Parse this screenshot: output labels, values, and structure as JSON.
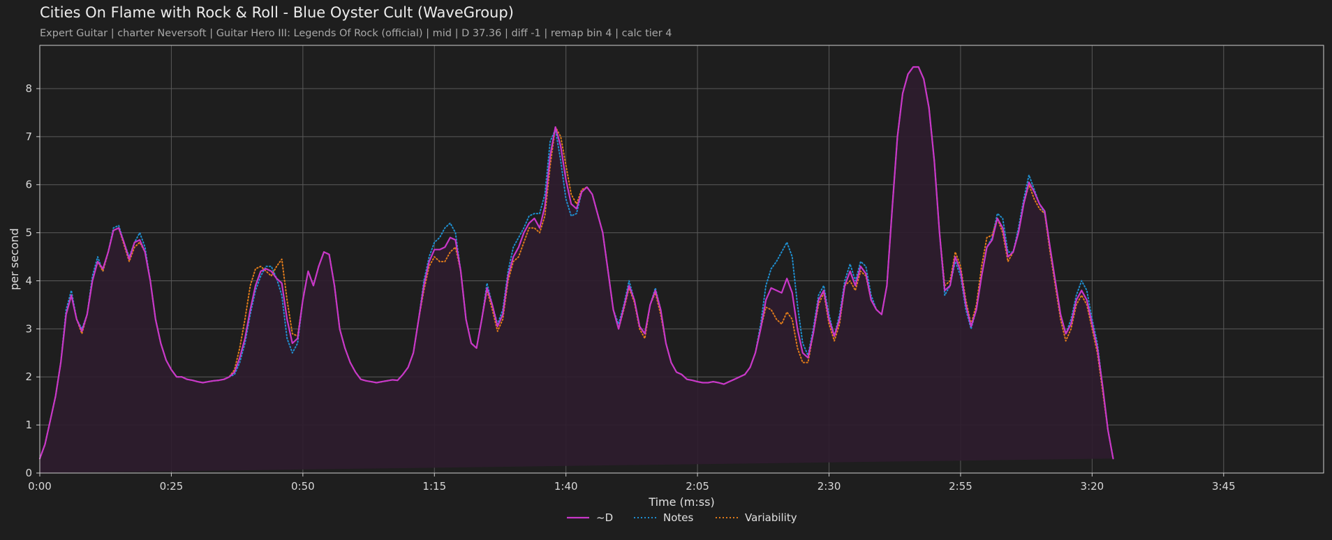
{
  "header": {
    "title": "Cities On Flame with Rock & Roll - Blue Oyster Cult (WaveGroup)",
    "subtitle": "Expert Guitar  |  charter Neversoft  |  Guitar Hero III: Legends Of Rock (official)  |  mid  |  D 37.36  |  diff -1  |  remap bin 4  |  calc tier 4"
  },
  "colors": {
    "background": "#1e1e1e",
    "d_line": "#c837c8",
    "d_fill": "#2e1c2e",
    "notes_line": "#1f8fd0",
    "variability_line": "#e07b1a",
    "grid": "#5a5a5a"
  },
  "chart_data": {
    "type": "line",
    "xlabel": "Time (m:ss)",
    "ylabel": "per second",
    "xlim": [
      0,
      244
    ],
    "ylim": [
      0,
      8.9
    ],
    "grid": true,
    "legend_position": "bottom-center",
    "xticks": [
      {
        "value": 0,
        "label": "0:00"
      },
      {
        "value": 25,
        "label": "0:25"
      },
      {
        "value": 50,
        "label": "0:50"
      },
      {
        "value": 75,
        "label": "1:15"
      },
      {
        "value": 100,
        "label": "1:40"
      },
      {
        "value": 125,
        "label": "2:05"
      },
      {
        "value": 150,
        "label": "2:30"
      },
      {
        "value": 175,
        "label": "2:55"
      },
      {
        "value": 200,
        "label": "3:20"
      },
      {
        "value": 225,
        "label": "3:45"
      }
    ],
    "yticks": [
      0,
      1,
      2,
      3,
      4,
      5,
      6,
      7,
      8
    ],
    "x": [
      0,
      1,
      2,
      3,
      4,
      5,
      6,
      7,
      8,
      9,
      10,
      11,
      12,
      13,
      14,
      15,
      16,
      17,
      18,
      19,
      20,
      21,
      22,
      23,
      24,
      25,
      26,
      27,
      28,
      29,
      30,
      31,
      32,
      33,
      34,
      35,
      36,
      37,
      38,
      39,
      40,
      41,
      42,
      43,
      44,
      45,
      46,
      47,
      48,
      49,
      50,
      51,
      52,
      53,
      54,
      55,
      56,
      57,
      58,
      59,
      60,
      61,
      62,
      63,
      64,
      65,
      66,
      67,
      68,
      69,
      70,
      71,
      72,
      73,
      74,
      75,
      76,
      77,
      78,
      79,
      80,
      81,
      82,
      83,
      84,
      85,
      86,
      87,
      88,
      89,
      90,
      91,
      92,
      93,
      94,
      95,
      96,
      97,
      98,
      99,
      100,
      101,
      102,
      103,
      104,
      105,
      106,
      107,
      108,
      109,
      110,
      111,
      112,
      113,
      114,
      115,
      116,
      117,
      118,
      119,
      120,
      121,
      122,
      123,
      124,
      125,
      126,
      127,
      128,
      129,
      130,
      131,
      132,
      133,
      134,
      135,
      136,
      137,
      138,
      139,
      140,
      141,
      142,
      143,
      144,
      145,
      146,
      147,
      148,
      149,
      150,
      151,
      152,
      153,
      154,
      155,
      156,
      157,
      158,
      159,
      160,
      161,
      162,
      163,
      164,
      165,
      166,
      167,
      168,
      169,
      170,
      171,
      172,
      173,
      174,
      175,
      176,
      177,
      178,
      179,
      180,
      181,
      182,
      183,
      184,
      185,
      186,
      187,
      188,
      189,
      190,
      191,
      192,
      193,
      194,
      195,
      196,
      197,
      198,
      199,
      200,
      201,
      202,
      203,
      204,
      205,
      206,
      207,
      208,
      209,
      210,
      211,
      212,
      213,
      214,
      215,
      216,
      217,
      218,
      219,
      220,
      221,
      222,
      223,
      224,
      225,
      226,
      227,
      228,
      229,
      230,
      231,
      232,
      233,
      234,
      235,
      236,
      237,
      238,
      239,
      240,
      241,
      242,
      243,
      244
    ],
    "series": [
      {
        "name": "~D",
        "style": "solid",
        "values": [
          0.3,
          0.6,
          1.1,
          1.6,
          2.3,
          3.3,
          3.7,
          3.2,
          2.95,
          3.3,
          4.0,
          4.4,
          4.25,
          4.6,
          5.05,
          5.1,
          4.8,
          4.45,
          4.8,
          4.85,
          4.6,
          4.0,
          3.2,
          2.7,
          2.35,
          2.15,
          2.0,
          2.0,
          1.95,
          1.93,
          1.9,
          1.88,
          1.9,
          1.92,
          1.93,
          1.95,
          2.0,
          2.1,
          2.4,
          2.8,
          3.4,
          3.9,
          4.2,
          4.25,
          4.2,
          4.05,
          3.95,
          3.2,
          2.7,
          2.8,
          3.6,
          4.2,
          3.9,
          4.3,
          4.6,
          4.55,
          3.9,
          3.0,
          2.6,
          2.3,
          2.1,
          1.95,
          1.92,
          1.9,
          1.88,
          1.9,
          1.92,
          1.94,
          1.93,
          2.05,
          2.2,
          2.5,
          3.2,
          3.9,
          4.4,
          4.65,
          4.65,
          4.7,
          4.9,
          4.85,
          4.2,
          3.2,
          2.7,
          2.6,
          3.2,
          3.85,
          3.5,
          3.05,
          3.3,
          4.1,
          4.5,
          4.7,
          5.0,
          5.2,
          5.3,
          5.1,
          5.55,
          6.6,
          7.2,
          6.8,
          6.1,
          5.6,
          5.5,
          5.85,
          5.95,
          5.8,
          5.4,
          5.0,
          4.2,
          3.4,
          3.0,
          3.45,
          3.9,
          3.6,
          3.05,
          2.9,
          3.5,
          3.8,
          3.4,
          2.7,
          2.3,
          2.1,
          2.05,
          1.95,
          1.93,
          1.9,
          1.88,
          1.88,
          1.9,
          1.88,
          1.85,
          1.9,
          1.95,
          2.0,
          2.05,
          2.2,
          2.5,
          3.0,
          3.6,
          3.85,
          3.8,
          3.75,
          4.05,
          3.75,
          3.0,
          2.5,
          2.4,
          2.9,
          3.6,
          3.8,
          3.2,
          2.85,
          3.2,
          3.9,
          4.2,
          3.9,
          4.3,
          4.15,
          3.6,
          3.4,
          3.3,
          3.9,
          5.5,
          7.0,
          7.9,
          8.3,
          8.45,
          8.45,
          8.2,
          7.6,
          6.5,
          5.0,
          3.8,
          3.9,
          4.5,
          4.2,
          3.5,
          3.05,
          3.4,
          4.1,
          4.7,
          4.85,
          5.3,
          5.1,
          4.5,
          4.6,
          5.0,
          5.6,
          6.05,
          5.85,
          5.6,
          5.45,
          4.7,
          4.0,
          3.3,
          2.9,
          3.1,
          3.6,
          3.8,
          3.6,
          3.1,
          2.6,
          1.8,
          0.9,
          0.3
        ]
      },
      {
        "name": "Notes",
        "style": "dotted",
        "values": [
          0.3,
          0.6,
          1.1,
          1.6,
          2.3,
          3.4,
          3.8,
          3.2,
          3.0,
          3.3,
          4.1,
          4.5,
          4.2,
          4.6,
          5.1,
          5.15,
          4.8,
          4.5,
          4.8,
          5.0,
          4.7,
          4.0,
          3.2,
          2.7,
          2.35,
          2.15,
          2.0,
          2.0,
          1.95,
          1.93,
          1.9,
          1.88,
          1.9,
          1.92,
          1.93,
          1.95,
          2.0,
          2.05,
          2.3,
          2.7,
          3.3,
          3.8,
          4.1,
          4.3,
          4.3,
          4.05,
          3.7,
          2.8,
          2.5,
          2.7,
          3.6,
          4.2,
          3.9,
          4.3,
          4.6,
          4.55,
          3.9,
          3.0,
          2.6,
          2.3,
          2.1,
          1.95,
          1.92,
          1.9,
          1.88,
          1.9,
          1.92,
          1.94,
          1.93,
          2.05,
          2.2,
          2.5,
          3.2,
          4.0,
          4.5,
          4.8,
          4.9,
          5.1,
          5.2,
          5.0,
          4.2,
          3.2,
          2.7,
          2.6,
          3.2,
          3.95,
          3.5,
          3.1,
          3.4,
          4.2,
          4.7,
          4.9,
          5.1,
          5.35,
          5.4,
          5.4,
          5.8,
          6.9,
          7.15,
          6.5,
          5.7,
          5.35,
          5.4,
          5.85,
          5.95,
          5.8,
          5.4,
          5.0,
          4.2,
          3.4,
          3.1,
          3.5,
          4.0,
          3.6,
          3.05,
          2.9,
          3.5,
          3.85,
          3.4,
          2.7,
          2.3,
          2.1,
          2.05,
          1.95,
          1.93,
          1.9,
          1.88,
          1.88,
          1.9,
          1.88,
          1.85,
          1.9,
          1.95,
          2.0,
          2.05,
          2.2,
          2.5,
          3.1,
          3.9,
          4.25,
          4.4,
          4.6,
          4.8,
          4.5,
          3.5,
          2.7,
          2.45,
          3.0,
          3.7,
          3.9,
          3.3,
          2.85,
          3.3,
          4.0,
          4.35,
          4.0,
          4.4,
          4.3,
          3.7,
          3.4,
          3.3,
          3.9,
          5.5,
          7.0,
          7.9,
          8.3,
          8.45,
          8.45,
          8.2,
          7.6,
          6.5,
          5.0,
          3.7,
          3.9,
          4.4,
          4.1,
          3.4,
          3.0,
          3.4,
          4.1,
          4.7,
          4.9,
          5.4,
          5.3,
          4.6,
          4.6,
          5.1,
          5.7,
          6.2,
          5.9,
          5.6,
          5.4,
          4.7,
          4.0,
          3.3,
          2.9,
          3.2,
          3.7,
          4.0,
          3.8,
          3.2,
          2.7,
          1.8,
          0.9,
          0.3
        ]
      },
      {
        "name": "Variability",
        "style": "dotted",
        "values": [
          0.3,
          0.6,
          1.1,
          1.6,
          2.3,
          3.3,
          3.7,
          3.2,
          2.9,
          3.3,
          4.0,
          4.4,
          4.2,
          4.6,
          5.05,
          5.1,
          4.75,
          4.4,
          4.7,
          4.8,
          4.6,
          4.0,
          3.2,
          2.7,
          2.35,
          2.15,
          2.0,
          2.0,
          1.95,
          1.93,
          1.9,
          1.88,
          1.9,
          1.92,
          1.93,
          1.95,
          2.0,
          2.15,
          2.6,
          3.2,
          3.9,
          4.25,
          4.3,
          4.2,
          4.1,
          4.3,
          4.45,
          3.6,
          2.9,
          2.85,
          3.6,
          4.2,
          3.9,
          4.3,
          4.6,
          4.55,
          3.9,
          3.0,
          2.6,
          2.3,
          2.1,
          1.95,
          1.92,
          1.9,
          1.88,
          1.9,
          1.92,
          1.94,
          1.93,
          2.05,
          2.2,
          2.5,
          3.2,
          3.8,
          4.3,
          4.5,
          4.4,
          4.4,
          4.6,
          4.7,
          4.2,
          3.2,
          2.7,
          2.6,
          3.2,
          3.8,
          3.4,
          2.95,
          3.2,
          4.0,
          4.4,
          4.5,
          4.8,
          5.1,
          5.1,
          5.0,
          5.35,
          6.4,
          7.2,
          7.0,
          6.4,
          5.8,
          5.6,
          5.9,
          5.95,
          5.8,
          5.4,
          5.0,
          4.2,
          3.4,
          3.0,
          3.4,
          3.85,
          3.55,
          3.0,
          2.8,
          3.5,
          3.75,
          3.3,
          2.7,
          2.3,
          2.1,
          2.05,
          1.95,
          1.93,
          1.9,
          1.88,
          1.88,
          1.9,
          1.88,
          1.85,
          1.9,
          1.95,
          2.0,
          2.05,
          2.2,
          2.5,
          3.0,
          3.45,
          3.4,
          3.2,
          3.1,
          3.35,
          3.2,
          2.6,
          2.3,
          2.3,
          2.9,
          3.5,
          3.75,
          3.1,
          2.75,
          3.1,
          3.9,
          4.0,
          3.8,
          4.2,
          4.1,
          3.6,
          3.4,
          3.3,
          3.9,
          5.5,
          7.0,
          7.9,
          8.3,
          8.45,
          8.45,
          8.2,
          7.6,
          6.5,
          5.0,
          3.9,
          4.0,
          4.6,
          4.3,
          3.6,
          3.1,
          3.5,
          4.3,
          4.9,
          4.95,
          5.3,
          5.0,
          4.4,
          4.6,
          5.0,
          5.6,
          6.0,
          5.7,
          5.5,
          5.4,
          4.6,
          3.9,
          3.2,
          2.75,
          3.0,
          3.5,
          3.7,
          3.5,
          3.0,
          2.5,
          1.7,
          0.9,
          0.3
        ]
      }
    ]
  }
}
